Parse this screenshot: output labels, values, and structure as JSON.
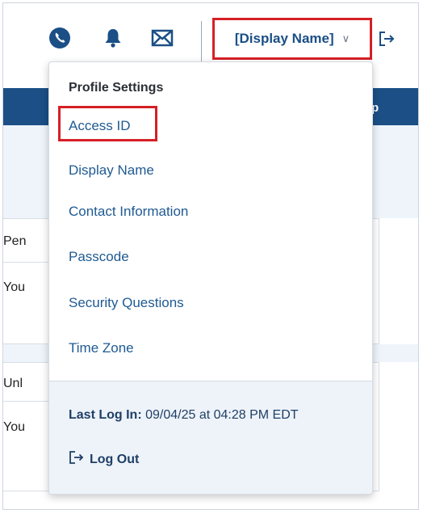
{
  "header": {
    "display_name_label": "[Display Name]",
    "display_name_chevron": "∨",
    "icons": [
      "phone-icon",
      "bell-icon",
      "mail-icon",
      "logout-icon"
    ]
  },
  "background": {
    "bar_text": "p",
    "row_texts": [
      "Pen",
      "You",
      "Unl",
      "You"
    ]
  },
  "dropdown": {
    "heading": "Profile Settings",
    "items": [
      {
        "label": "Access ID",
        "highlighted": true
      },
      {
        "label": "Display Name"
      },
      {
        "label": "Contact Information"
      },
      {
        "label": "Passcode"
      },
      {
        "label": "Security Questions"
      },
      {
        "label": "Time Zone"
      }
    ],
    "last_login_label": "Last Log In:",
    "last_login_value": "09/04/25 at 04:28 PM EDT",
    "logout_label": "Log Out"
  },
  "colors": {
    "brand_blue": "#1b4f86",
    "link_blue": "#1f5a92",
    "highlight_red": "#d61f26",
    "panel_bg": "#eef4fa"
  }
}
